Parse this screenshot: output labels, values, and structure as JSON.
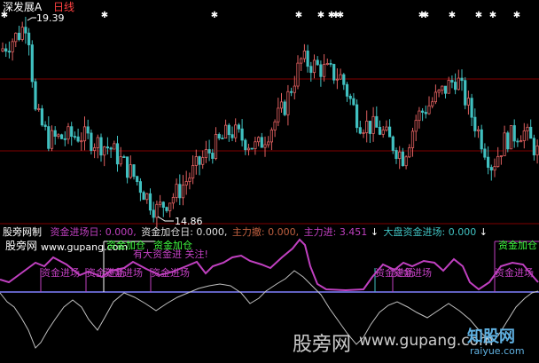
{
  "header": {
    "title": "深发展A",
    "period": "日线",
    "high_price": "19.39",
    "low_price": "14.86"
  },
  "indicator_bar": {
    "name": "股旁网制",
    "items": [
      {
        "label": "资金进场日",
        "value": "0.000,",
        "color": "#c040c0"
      },
      {
        "label": "资金加仓日",
        "value": "0.000,",
        "color": "#e0e0e0"
      },
      {
        "label": "主力撤",
        "value": "0.000,",
        "color": "#c06040"
      },
      {
        "label": "主力进",
        "value": "3.451",
        "color": "#c040c0"
      },
      {
        "label": "大盘资金进场",
        "value": "0.000",
        "color": "#40c0c0"
      }
    ],
    "arrows": [
      "↓",
      "↓"
    ]
  },
  "labels": {
    "site_cn": "股旁网",
    "site_url": "www.gupang.com",
    "jinchang": "资金进场",
    "jiacang": "资金加仓",
    "big_money": "有大资金进  关注!"
  },
  "watermarks": {
    "site_cn": "股旁网",
    "site_url": "www.gupang.com",
    "logo": "知股网",
    "logo_url": "raiyue.com"
  },
  "colors": {
    "up": "#e06060",
    "down": "#40c0c0",
    "purple_line": "#c040c0",
    "gray_line": "#c0c0c0",
    "baseline": "#8080ff",
    "hline": "#800000",
    "signal": "#ffffff"
  },
  "chart_data": {
    "type": "candlestick",
    "price_high": 19.39,
    "price_low": 14.86,
    "candle_count": 164,
    "signal_marker_count": 14
  }
}
